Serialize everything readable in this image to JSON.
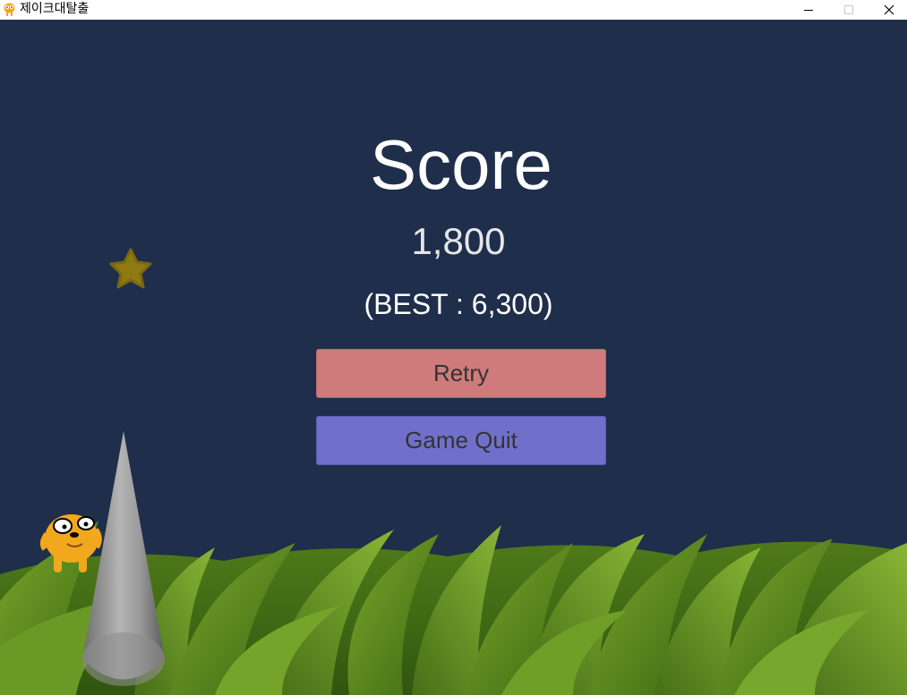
{
  "window": {
    "title": "제이크대탈출",
    "icon": "jake-icon",
    "controls": [
      "minimize-icon",
      "maximize-icon",
      "close-icon"
    ]
  },
  "hud": {
    "score_heading": "Score",
    "score_value": "1,800",
    "best_prefix": "(BEST : ",
    "best_value": "6,300",
    "best_suffix": ")"
  },
  "menu": {
    "retry_label": "Retry",
    "quit_label": "Game Quit"
  },
  "colors": {
    "sky": "#1f2e4b",
    "retry_button": "#cf7b7c",
    "quit_button": "#7070cb",
    "star": "#8f7a12",
    "grass": "#5e8f1f"
  }
}
